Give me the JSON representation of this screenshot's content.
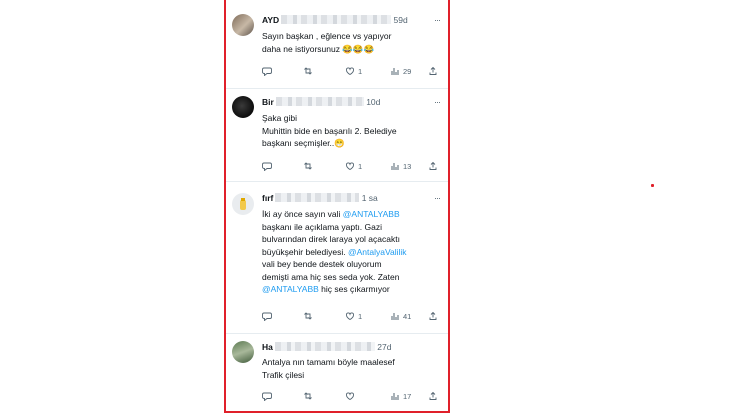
{
  "tweets": [
    {
      "name": "AYD",
      "time": "59d",
      "text": "Sayın başkan , eğlence vs yapıyor\ndaha ne istiyorsunuz 😂😂😂",
      "replies": "",
      "retweets": "",
      "likes": "1",
      "views": "29"
    },
    {
      "name": "Bir",
      "time": "10d",
      "text": "Şaka gibi\nMuhittin bide en başarılı 2. Belediye\nbaşkanı seçmişler..😁",
      "replies": "",
      "retweets": "",
      "likes": "1",
      "views": "13"
    },
    {
      "name": "fırf",
      "time": "1 sa",
      "text_parts": [
        "İki ay önce sayın vali ",
        "@ANTALYABB",
        "\nbaşkanı ile açıklama yaptı. Gazi\nbulvarından direk laraya yol açacaktı\nbüyükşehir belediyesi. ",
        "@AntalyaValilik",
        "\nvali bey bende destek oluyorum\ndemişti ama hiç ses seda yok. Zaten\n",
        "@ANTALYABB",
        " hiç ses çıkarmıyor"
      ],
      "replies": "",
      "retweets": "",
      "likes": "1",
      "views": "41"
    },
    {
      "name": "Ha",
      "time": "27d",
      "text": "Antalya nın tamamı böyle maalesef\nTrafik çilesi",
      "replies": "",
      "retweets": "",
      "likes": "",
      "views": "17"
    }
  ],
  "colors": {
    "accent": "#1d9bf0",
    "frame": "#e0202a",
    "muted": "#536471"
  },
  "icons": [
    "reply-icon",
    "retweet-icon",
    "like-icon",
    "views-icon",
    "share-icon",
    "more-icon"
  ]
}
